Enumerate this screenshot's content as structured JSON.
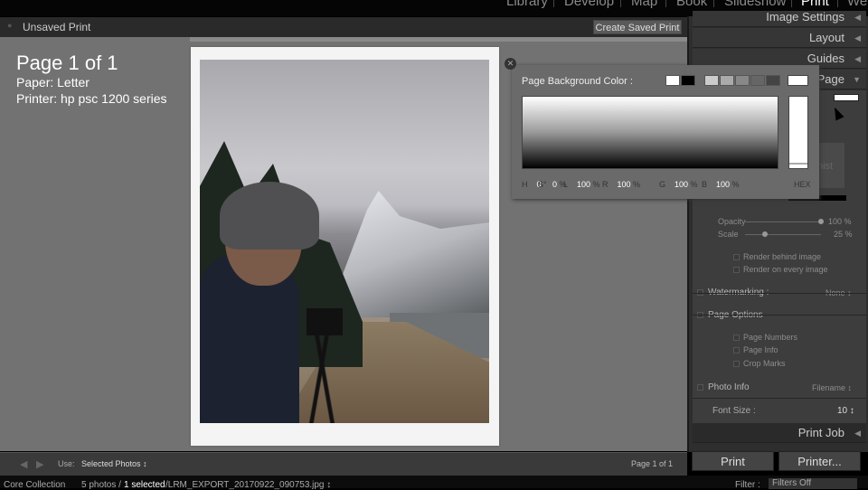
{
  "modules": {
    "items": [
      "Library",
      "Develop",
      "Map",
      "Book",
      "Slideshow",
      "Print",
      "Web"
    ],
    "active": "Print"
  },
  "title": {
    "text": "Unsaved Print",
    "create_saved_print": "Create Saved Print"
  },
  "page_info": {
    "title": "Page 1 of 1",
    "paper": "Paper:  Letter",
    "printer": "Printer:  hp psc 1200 series"
  },
  "right_panel": {
    "headers": {
      "image_settings": "Image Settings",
      "layout": "Layout",
      "guides": "Guides",
      "page": "Page",
      "print_job": "Print Job"
    },
    "overlay_text": "hist",
    "opacity": {
      "label": "Opacity",
      "value": "100 %",
      "level": 100
    },
    "scale": {
      "label": "Scale",
      "value": "25 %",
      "level": 25
    },
    "render_behind": "Render behind image",
    "render_every": "Render on every image",
    "watermarking": {
      "label": "Watermarking :",
      "value": "None ↕"
    },
    "page_options": {
      "label": "Page Options",
      "items": [
        "Page Numbers",
        "Page Info",
        "Crop Marks"
      ]
    },
    "photo_info": {
      "label": "Photo Info",
      "value": "Filename ↕"
    },
    "font_size": {
      "label": "Font Size :",
      "value": "10 ↕"
    },
    "print_button": "Print",
    "printer_button": "Printer..."
  },
  "color_picker": {
    "title": "Page Background Color :",
    "swatches": [
      "#ffffff",
      "#000000",
      "#cccccc",
      "#aaaaaa",
      "#888888",
      "#666666",
      "#444444"
    ],
    "current": "#ffffff",
    "fields": [
      {
        "k": "H",
        "v": "0",
        "u": "°"
      },
      {
        "k": "S",
        "v": "0",
        "u": "%"
      },
      {
        "k": "L",
        "v": "100",
        "u": "%"
      },
      {
        "k": "R",
        "v": "100",
        "u": "%"
      },
      {
        "k": "G",
        "v": "100",
        "u": "%"
      },
      {
        "k": "B",
        "v": "100",
        "u": "%"
      }
    ],
    "hex_label": "HEX"
  },
  "toolbar": {
    "use_label": "Use:",
    "use_value": "Selected Photos ↕",
    "page_count": "Page 1 of 1"
  },
  "filmstrip": {
    "collection": "Core Collection",
    "count": "5 photos /",
    "selected": "1 selected",
    "file": "/LRM_EXPORT_20170922_090753.jpg ↕",
    "filter_label": "Filter :",
    "filter_value": "Filters Off"
  }
}
